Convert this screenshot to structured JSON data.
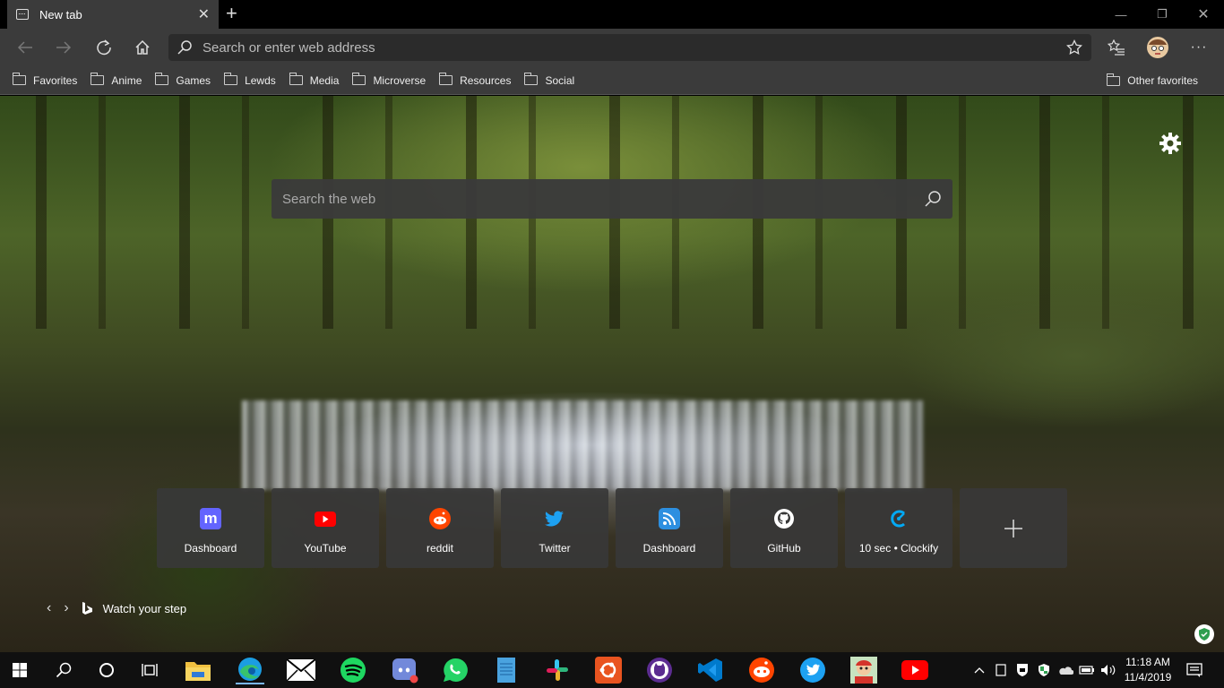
{
  "tab": {
    "title": "New tab"
  },
  "address": {
    "placeholder": "Search or enter web address"
  },
  "favorites": {
    "items": [
      "Favorites",
      "Anime",
      "Games",
      "Lewds",
      "Media",
      "Microverse",
      "Resources",
      "Social"
    ],
    "other": "Other favorites"
  },
  "newtab": {
    "search_placeholder": "Search the web",
    "tiles": [
      {
        "label": "Dashboard",
        "icon": "mastodon-icon",
        "color": "#6364ff"
      },
      {
        "label": "YouTube",
        "icon": "youtube-icon",
        "color": "#ff0000"
      },
      {
        "label": "reddit",
        "icon": "reddit-icon",
        "color": "#ff4500"
      },
      {
        "label": "Twitter",
        "icon": "twitter-icon",
        "color": "#1da1f2"
      },
      {
        "label": "Dashboard",
        "icon": "rss-icon",
        "color": "#2d8fe0"
      },
      {
        "label": "GitHub",
        "icon": "github-icon",
        "color": "#ffffff"
      },
      {
        "label": "10 sec • Clockify",
        "icon": "clockify-icon",
        "color": "#03a9f4"
      }
    ],
    "image_caption": "Watch your step"
  },
  "taskbar": {
    "apps": [
      "file-explorer-icon",
      "edge-icon",
      "mail-icon",
      "spotify-icon",
      "discord-icon",
      "whatsapp-icon",
      "notepad-icon",
      "slack-icon",
      "ubuntu-icon",
      "gitkraken-icon",
      "vscode-icon",
      "reddit-icon",
      "twitter-icon",
      "game-icon",
      "youtube-icon"
    ],
    "time": "11:18 AM",
    "date": "11/4/2019"
  }
}
